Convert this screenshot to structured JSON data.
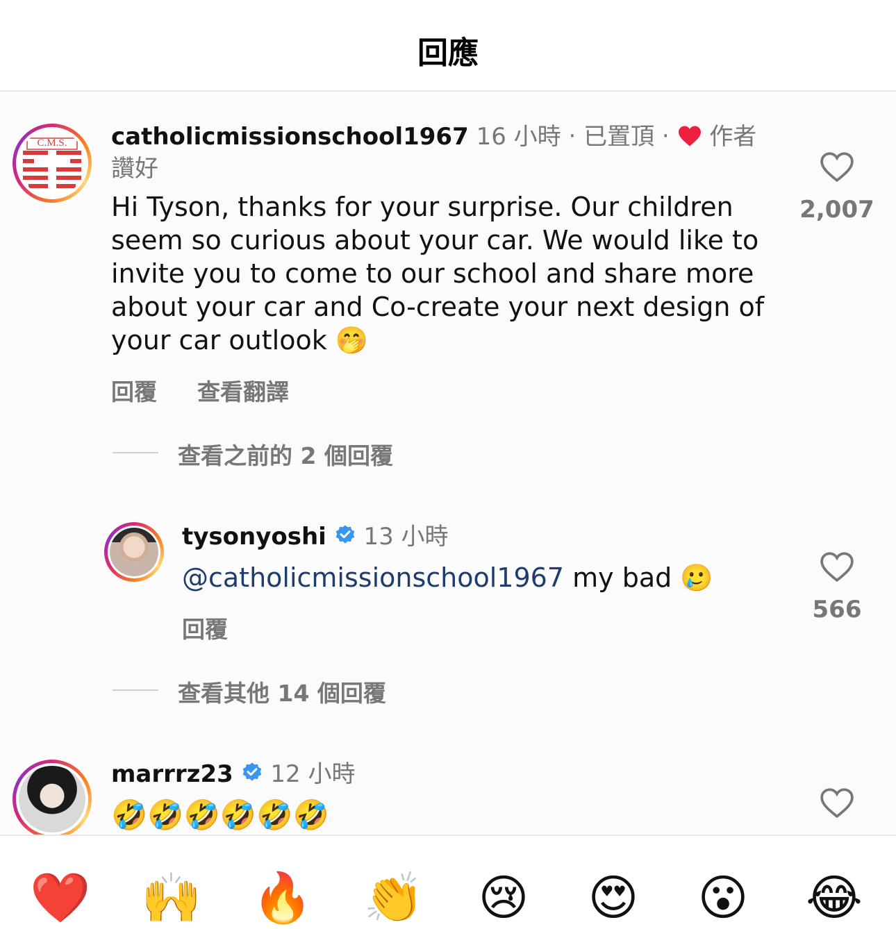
{
  "header": {
    "title": "回應"
  },
  "comments": [
    {
      "username": "catholicmissionschool1967",
      "time": "16 小時",
      "pinned": "‧ 已置頂 ‧",
      "author_liked_label": "作者讚好",
      "text": "Hi Tyson, thanks for your surprise. Our children seem so curious about your car. We would like to invite you to come to our school and share more about your car and Co-create your next design of your car outlook",
      "emoji": "🤭",
      "reply_label": "回覆",
      "translate_label": "查看翻譯",
      "like_count": "2,007",
      "view_previous": "查看之前的 2 個回覆",
      "avatar_text": "C.M.S."
    },
    {
      "username": "tysonyoshi",
      "verified": true,
      "time": "13 小時",
      "mention": "@catholicmissionschool1967",
      "text": "my bad",
      "emoji": "🥲",
      "reply_label": "回覆",
      "like_count": "566",
      "view_more": "查看其他 14 個回覆"
    },
    {
      "username": "marrrz23",
      "verified": true,
      "time": "12 小時",
      "emojis": "🤣🤣🤣🤣🤣🤣"
    }
  ],
  "reactions": [
    "❤️",
    "🙌",
    "🔥",
    "👏",
    "😢",
    "😍",
    "😮",
    "😂"
  ],
  "colors": {
    "verified": "#3797f0",
    "heart": "#ed2040",
    "mention": "#1f3c6e"
  }
}
